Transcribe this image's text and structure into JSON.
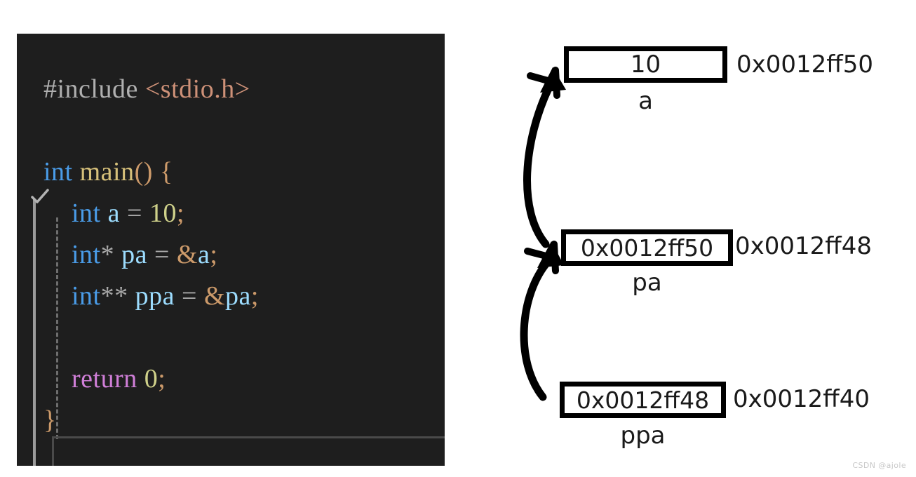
{
  "editor": {
    "name": "code-editor",
    "background": "#1e1e1e",
    "fold_marker_icon": "check-icon",
    "lines": [
      {
        "id": "l1",
        "tokens": [
          {
            "text": "#include ",
            "cls": "t-pre"
          },
          {
            "text": "<stdio.h>",
            "cls": "t-hdr"
          }
        ]
      },
      {
        "id": "l2",
        "tokens": []
      },
      {
        "id": "l3",
        "tokens": [
          {
            "text": "int",
            "cls": "t-kw"
          },
          {
            "text": " ",
            "cls": "t-op"
          },
          {
            "text": "main",
            "cls": "t-fn"
          },
          {
            "text": "()",
            "cls": "t-punct"
          },
          {
            "text": " ",
            "cls": "t-op"
          },
          {
            "text": "{",
            "cls": "t-brace"
          }
        ]
      },
      {
        "id": "l4",
        "tokens": [
          {
            "text": "    ",
            "cls": "t-op"
          },
          {
            "text": "int",
            "cls": "t-kw"
          },
          {
            "text": " ",
            "cls": "t-op"
          },
          {
            "text": "a",
            "cls": "t-var"
          },
          {
            "text": " ",
            "cls": "t-op"
          },
          {
            "text": "=",
            "cls": "t-op"
          },
          {
            "text": " ",
            "cls": "t-op"
          },
          {
            "text": "10",
            "cls": "t-num"
          },
          {
            "text": ";",
            "cls": "t-punct"
          }
        ]
      },
      {
        "id": "l5",
        "tokens": [
          {
            "text": "    ",
            "cls": "t-op"
          },
          {
            "text": "int",
            "cls": "t-kw"
          },
          {
            "text": "*",
            "cls": "t-op"
          },
          {
            "text": " ",
            "cls": "t-op"
          },
          {
            "text": "pa",
            "cls": "t-var"
          },
          {
            "text": " ",
            "cls": "t-op"
          },
          {
            "text": "=",
            "cls": "t-op"
          },
          {
            "text": " ",
            "cls": "t-op"
          },
          {
            "text": "&",
            "cls": "t-amp"
          },
          {
            "text": "a",
            "cls": "t-var"
          },
          {
            "text": ";",
            "cls": "t-punct"
          }
        ]
      },
      {
        "id": "l6",
        "tokens": [
          {
            "text": "    ",
            "cls": "t-op"
          },
          {
            "text": "int",
            "cls": "t-kw"
          },
          {
            "text": "**",
            "cls": "t-op"
          },
          {
            "text": " ",
            "cls": "t-op"
          },
          {
            "text": "ppa",
            "cls": "t-var"
          },
          {
            "text": " ",
            "cls": "t-op"
          },
          {
            "text": "=",
            "cls": "t-op"
          },
          {
            "text": " ",
            "cls": "t-op"
          },
          {
            "text": "&",
            "cls": "t-amp"
          },
          {
            "text": "pa",
            "cls": "t-var"
          },
          {
            "text": ";",
            "cls": "t-punct"
          }
        ]
      },
      {
        "id": "l7",
        "tokens": []
      },
      {
        "id": "l8",
        "tokens": [
          {
            "text": "    ",
            "cls": "t-op"
          },
          {
            "text": "return",
            "cls": "t-ret"
          },
          {
            "text": " ",
            "cls": "t-op"
          },
          {
            "text": "0",
            "cls": "t-num"
          },
          {
            "text": ";",
            "cls": "t-punct"
          }
        ]
      },
      {
        "id": "l9",
        "tokens": [
          {
            "text": "}",
            "cls": "t-brace"
          }
        ]
      }
    ],
    "plain_source": "#include <stdio.h>\n\nint main() {\n    int a = 10;\n    int* pa = &a;\n    int** ppa = &pa;\n\n    return 0;\n}"
  },
  "diagram": {
    "title": "pointer-memory-layout",
    "cells": [
      {
        "id": "a",
        "value": "10",
        "variable_label": "a",
        "address": "0x0012ff50"
      },
      {
        "id": "pa",
        "value": "0x0012ff50",
        "variable_label": "pa",
        "address": "0x0012ff48"
      },
      {
        "id": "ppa",
        "value": "0x0012ff48",
        "variable_label": "ppa",
        "address": "0x0012ff40"
      }
    ],
    "arrows": [
      {
        "id": "arrow-pa-to-a",
        "from": "pa",
        "to": "a",
        "icon": "curved-arrow-icon"
      },
      {
        "id": "arrow-ppa-to-pa",
        "from": "ppa",
        "to": "pa",
        "icon": "curved-arrow-icon"
      }
    ]
  },
  "watermark": {
    "text": "CSDN @ajole"
  },
  "colors": {
    "editor_background": "#1e1e1e",
    "keyword": "#4a9ce8",
    "function": "#d6c07a",
    "header_string": "#ce9178",
    "number": "#cfd18a",
    "return_keyword": "#d07fd8",
    "variable": "#9cdcfe",
    "punctuation": "#cc9a6a",
    "preprocessor": "#b0b0b0",
    "diagram_stroke": "#000000",
    "page_background": "#ffffff"
  }
}
